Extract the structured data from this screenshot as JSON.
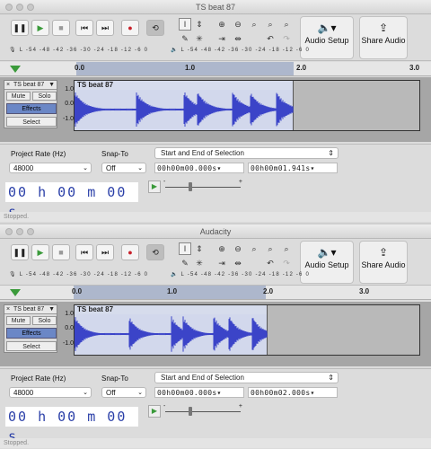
{
  "windows": [
    {
      "title": "TS beat 87",
      "track_name": "TS beat 87",
      "clip_name": "TS beat 87",
      "selection_start": "00h00m00.000s",
      "selection_end": "00h00m01.941s",
      "clip_length": 1.941
    },
    {
      "title": "Audacity",
      "track_name": "TS beat 87",
      "clip_name": "TS beat 87",
      "selection_start": "00h00m00.000s",
      "selection_end": "00h00m02.000s",
      "clip_length": 2.0
    }
  ],
  "toolbar": {
    "audio_setup": "Audio Setup",
    "share_audio": "Share Audio",
    "meter_rec_label": "R",
    "meter_play_label": "R",
    "meter_left_label": "L",
    "meter_scale": "-54 -48 -42 -36 -30 -24 -18 -12 -6 0",
    "icons": [
      "pause-icon",
      "play-icon",
      "stop-icon",
      "skip-start-icon",
      "skip-end-icon",
      "record-icon",
      "loop-icon"
    ]
  },
  "ruler": {
    "ticks": [
      "0.0",
      "1.0",
      "2.0",
      "3.0"
    ]
  },
  "track": {
    "mute": "Mute",
    "solo": "Solo",
    "effects": "Effects",
    "select": "Select",
    "scale_top": "1.0",
    "scale_mid": "0.0",
    "scale_bottom": "-1.0"
  },
  "bottom": {
    "project_rate_label": "Project Rate (Hz)",
    "project_rate_value": "48000",
    "snap_to_label": "Snap-To",
    "snap_to_value": "Off",
    "selection_mode": "Start and End of Selection",
    "big_time": "00 h 00 m 00 s",
    "slider_min": "-",
    "slider_max": "+"
  },
  "status": "Stopped.",
  "colors": {
    "waveform": "#3b44c8",
    "clip_bg": "#d2d8ec",
    "selection": "#adb7cc",
    "effects_button": "#6b87c6",
    "time_digits": "#2a3fa8",
    "play_green": "#3a9a3a",
    "record_red": "#c8202a"
  }
}
